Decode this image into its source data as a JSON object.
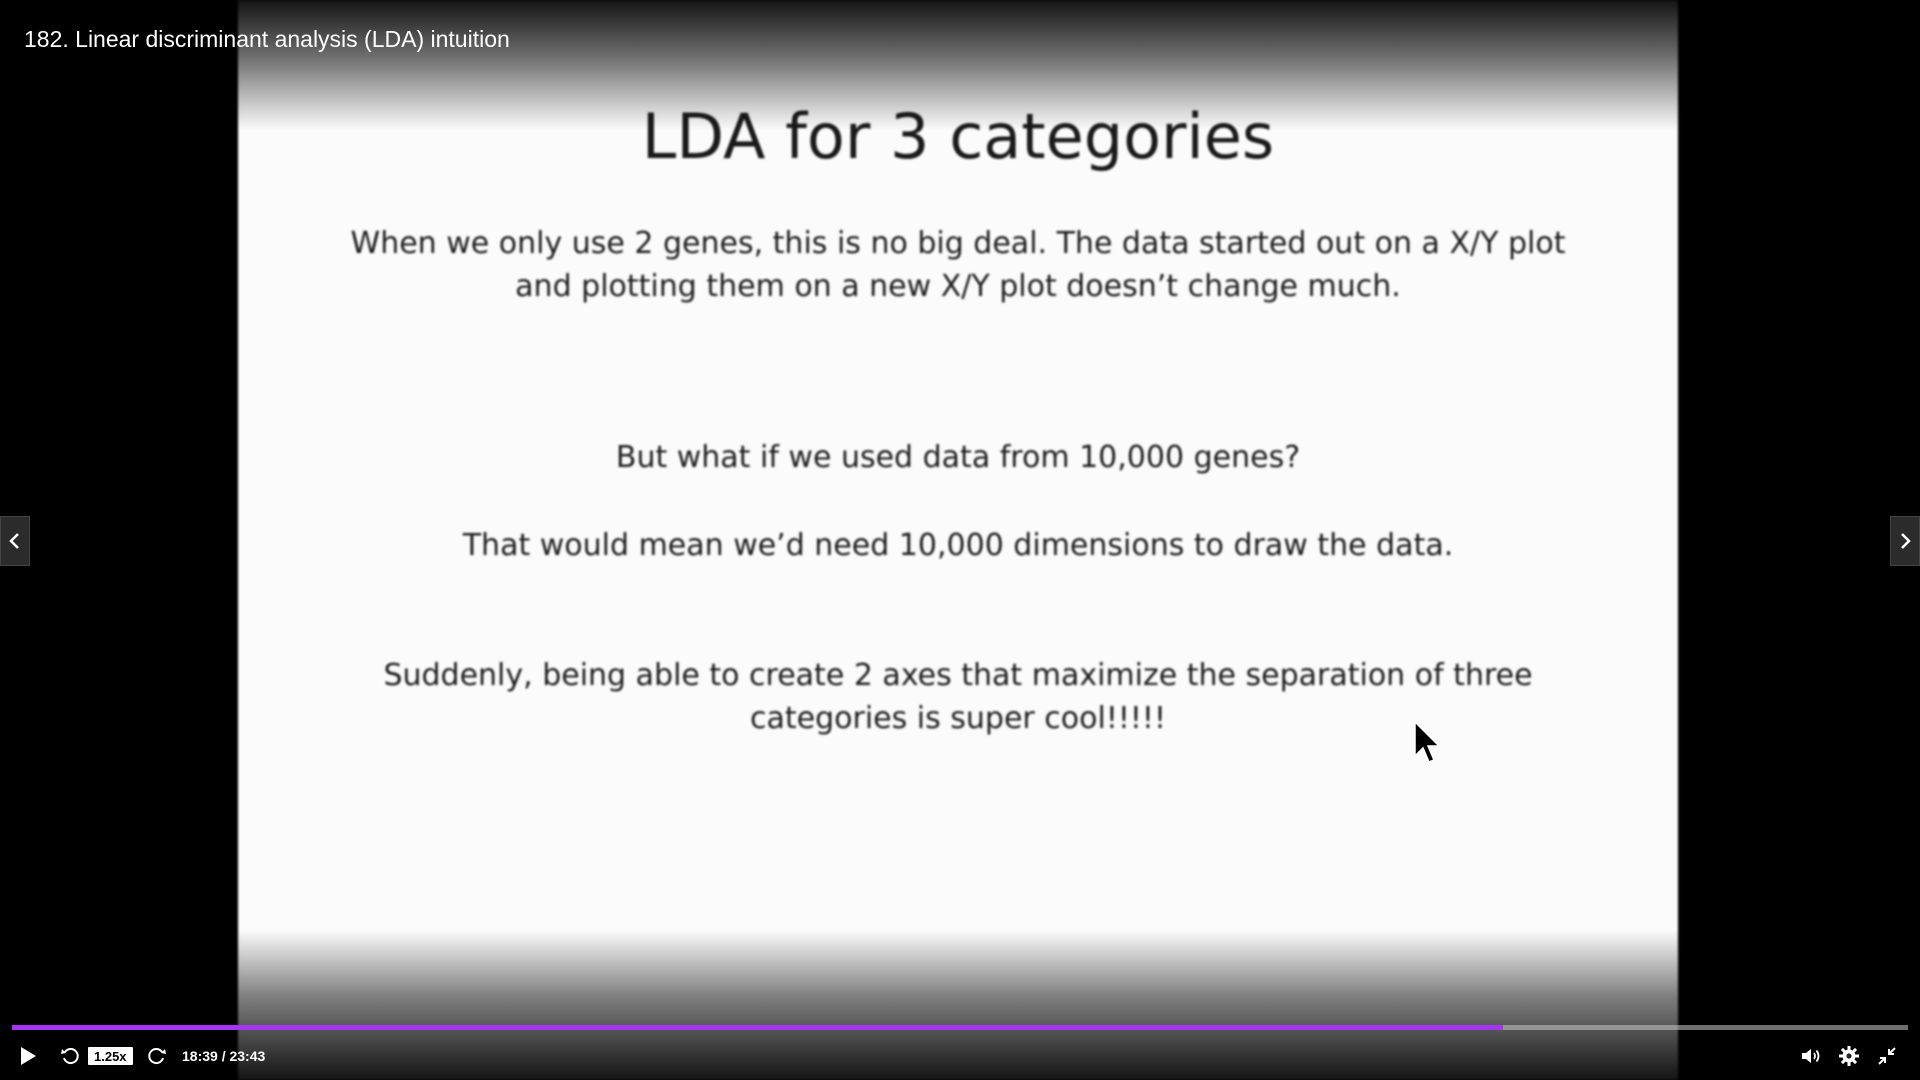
{
  "header": {
    "video_title": "182. Linear discriminant analysis (LDA) intuition"
  },
  "slide": {
    "title": "LDA for 3 categories",
    "paragraph_1": "When we only use 2 genes, this is no big deal. The data started out on a X/Y plot and plotting them on a new X/Y plot doesn’t change much.",
    "paragraph_2": "But what if we used data from 10,000 genes?",
    "paragraph_3": "That would mean we’d need 10,000 dimensions to draw the data.",
    "paragraph_4": "Suddenly, being able to create 2 axes that maximize the separation of three categories is super cool!!!!!"
  },
  "controls": {
    "play_icon": "play-icon",
    "rewind_icon": "rewind-icon",
    "forward_icon": "forward-icon",
    "speed_label": "1.25x",
    "time_label": "18:39 / 23:43",
    "volume_icon": "volume-icon",
    "settings_icon": "gear-icon",
    "fullscreen_icon": "exit-fullscreen-icon"
  },
  "progress": {
    "fraction": 0.7864,
    "fill_color": "#a435f0"
  },
  "nav": {
    "prev_icon": "chevron-left-icon",
    "next_icon": "chevron-right-icon"
  }
}
